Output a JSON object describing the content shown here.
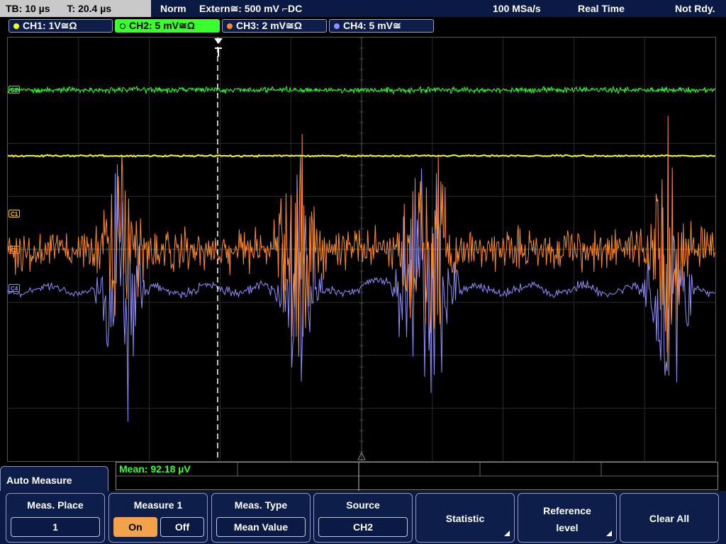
{
  "status_bar": {
    "timebase": "TB: 10 µs",
    "trigger_time": "T: 20.4 µs",
    "trigger_mode": "Norm",
    "trigger_source": "Extern≅: 500 mV ⌐DC",
    "sample_rate": "100 MSa/s",
    "acq_mode": "Real Time",
    "state": "Not Rdy."
  },
  "channels": [
    {
      "label": "CH1: 1V≅Ω",
      "color": "#ffff00",
      "marker": "C1"
    },
    {
      "label": "CH2: 5 mV≅Ω",
      "color": "#33ff33",
      "marker": "C2"
    },
    {
      "label": "CH3: 2 mV≅Ω",
      "color": "#ff8c2a",
      "marker": "C3"
    },
    {
      "label": "CH4: 5 mV≅",
      "color": "#8f8fff",
      "marker": "C4"
    }
  ],
  "active_channel": "CH2",
  "measurement": {
    "result": "Mean: 92.18 µV"
  },
  "menu": {
    "title": "Auto Measure",
    "keys": {
      "meas_place": {
        "label": "Meas. Place",
        "value": "1"
      },
      "measure1": {
        "label": "Measure 1",
        "on": "On",
        "off": "Off",
        "selected": "On"
      },
      "meas_type": {
        "label": "Meas. Type",
        "value": "Mean Value"
      },
      "source": {
        "label": "Source",
        "value": "CH2"
      },
      "statistic": {
        "label": "Statistic"
      },
      "ref_level": {
        "label_line1": "Reference",
        "label_line2": "level"
      },
      "clear_all": {
        "label": "Clear All"
      }
    }
  }
}
